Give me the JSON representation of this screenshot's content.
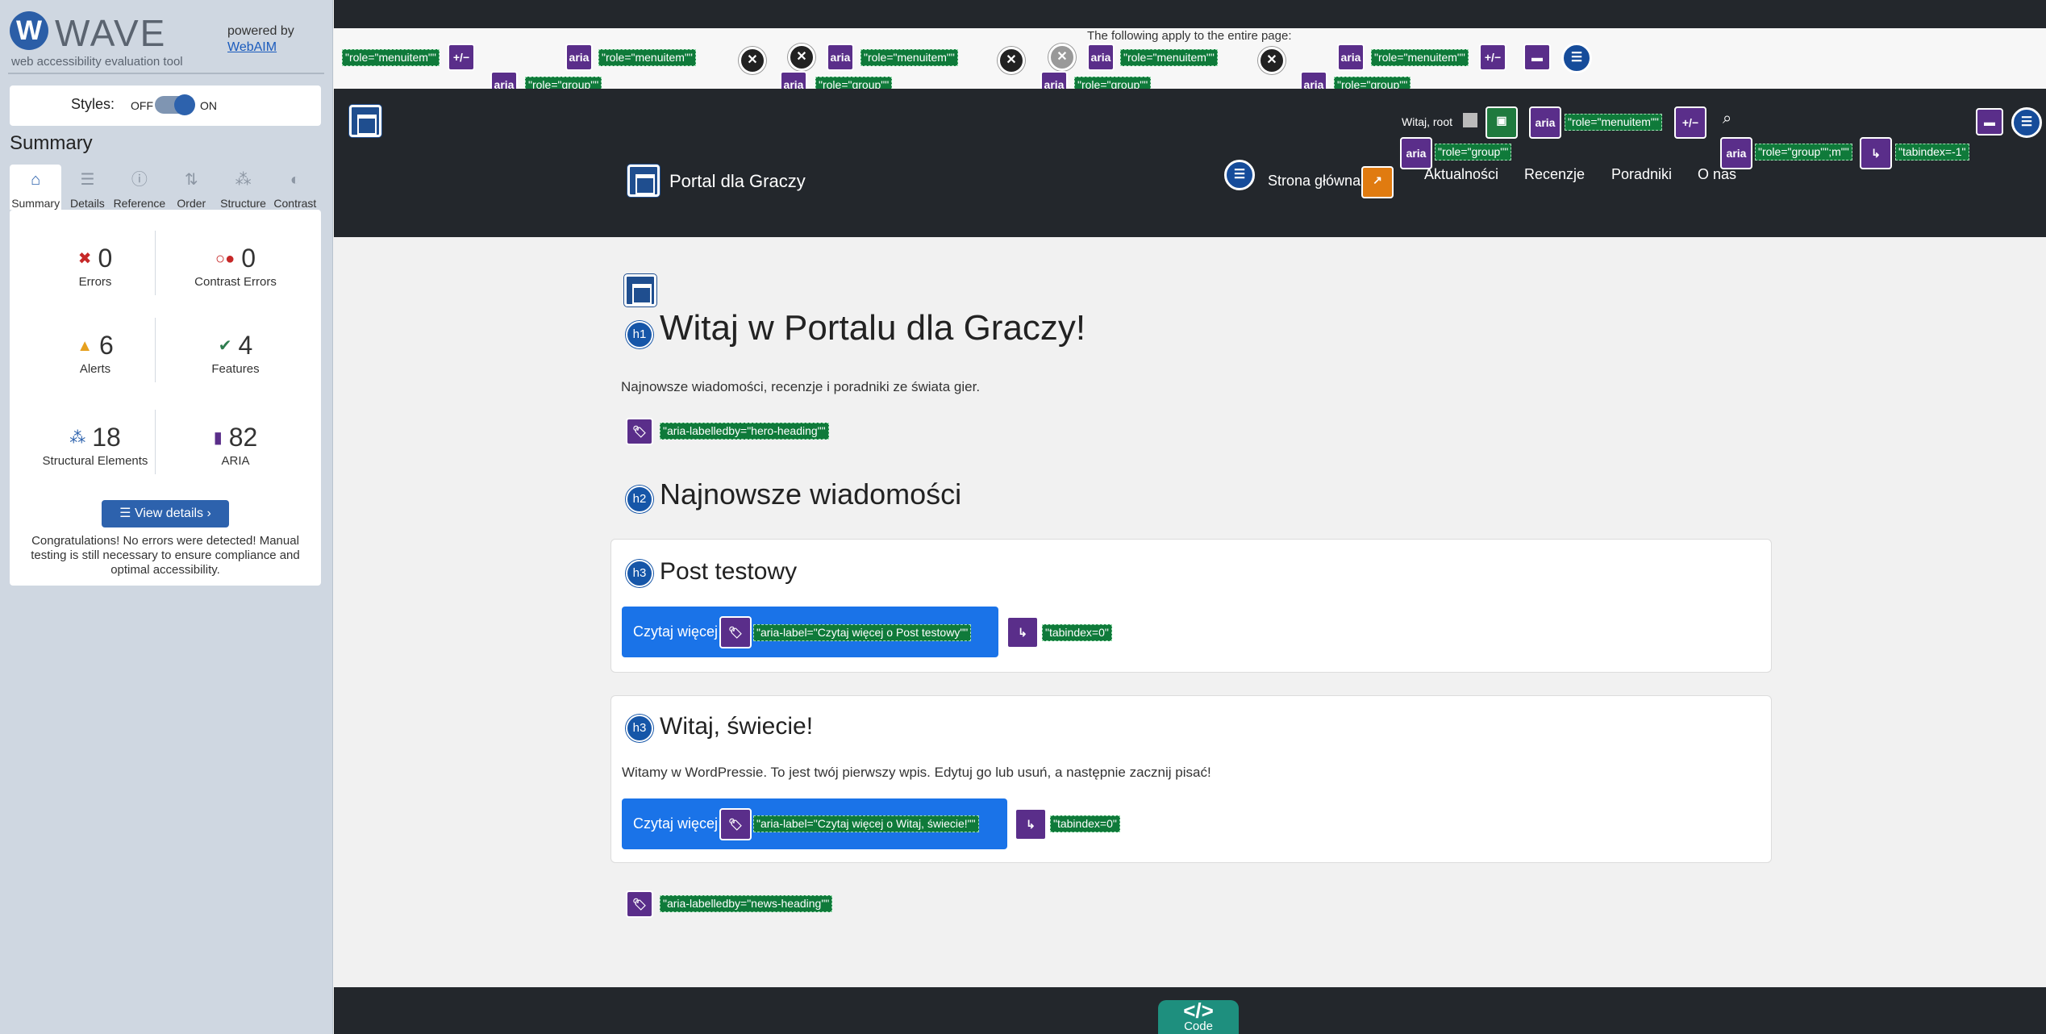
{
  "wave": {
    "logo_text": "WAVE",
    "logo_subtitle": "web accessibility evaluation tool",
    "powered_by": "powered by",
    "webaim_link": "WebAIM",
    "styles_label": "Styles:",
    "styles_off": "OFF",
    "styles_on": "ON",
    "styles_state": "on",
    "summary_title": "Summary",
    "tabs": [
      {
        "label": "Summary",
        "icon": "home-icon",
        "active": true
      },
      {
        "label": "Details",
        "icon": "list-icon"
      },
      {
        "label": "Reference",
        "icon": "info-icon"
      },
      {
        "label": "Order",
        "icon": "order-icon"
      },
      {
        "label": "Structure",
        "icon": "structure-icon"
      },
      {
        "label": "Contrast",
        "icon": "contrast-icon"
      }
    ],
    "stats": {
      "errors": {
        "count": "0",
        "label": "Errors",
        "color": "#c62828"
      },
      "contrast_errors": {
        "count": "0",
        "label": "Contrast Errors",
        "color": "#c62828"
      },
      "alerts": {
        "count": "6",
        "label": "Alerts",
        "color": "#e6a01e"
      },
      "features": {
        "count": "4",
        "label": "Features",
        "color": "#2e7d4f"
      },
      "structural": {
        "count": "18",
        "label": "Structural Elements",
        "color": "#2d62ad"
      },
      "aria": {
        "count": "82",
        "label": "ARIA",
        "color": "#5a2e8a"
      }
    },
    "view_details": "View details ›",
    "congrats": "Congratulations! No errors were detected! Manual testing is still necessary to ensure compliance and optimal accessibility."
  },
  "page": {
    "entire_page_note": "The following apply to the entire page:",
    "site_title": "Portal dla Graczy",
    "welcome": "Witaj, root",
    "nav": [
      "Strona główna",
      "Aktualności",
      "Recenzje",
      "Poradniki",
      "O nas"
    ],
    "hero_heading": "Witaj w Portalu dla Graczy!",
    "hero_lead": "Najnowsze wiadomości, recenzje i poradniki ze świata gier.",
    "news_heading": "Najnowsze wiadomości",
    "posts": [
      {
        "title": "Post testowy",
        "excerpt": "",
        "button": "Czytaj więcej",
        "aria_label": "\"aria-label=\"Czytaj więcej o Post testowy\"\"",
        "tabindex": "\"tabindex=0\""
      },
      {
        "title": "Witaj, świecie!",
        "excerpt": "Witamy w WordPressie. To jest twój pierwszy wpis. Edytuj go lub usuń, a następnie zacznij pisać!",
        "button": "Czytaj więcej",
        "aria_label": "\"aria-label=\"Czytaj więcej o Witaj, świecie!\"\"",
        "tabindex": "\"tabindex=0\""
      }
    ],
    "labelledby_hero": "\"aria-labelledby=\"hero-heading\"\"",
    "labelledby_news": "\"aria-labelledby=\"news-heading\"\"",
    "code_label": "Code",
    "code_glyph": "</>"
  },
  "annotations": {
    "role_menuitem": "\"role=\"menuitem\"\"",
    "role_group": "\"role=\"group\"\"",
    "role_group_m": "\"role=\"group\"\";m\"\"",
    "tabindex_neg": "\"tabindex=-1\"",
    "aria": "aria",
    "plusminus": "+/−",
    "h1": "h1",
    "h2": "h2",
    "h3": "h3"
  }
}
